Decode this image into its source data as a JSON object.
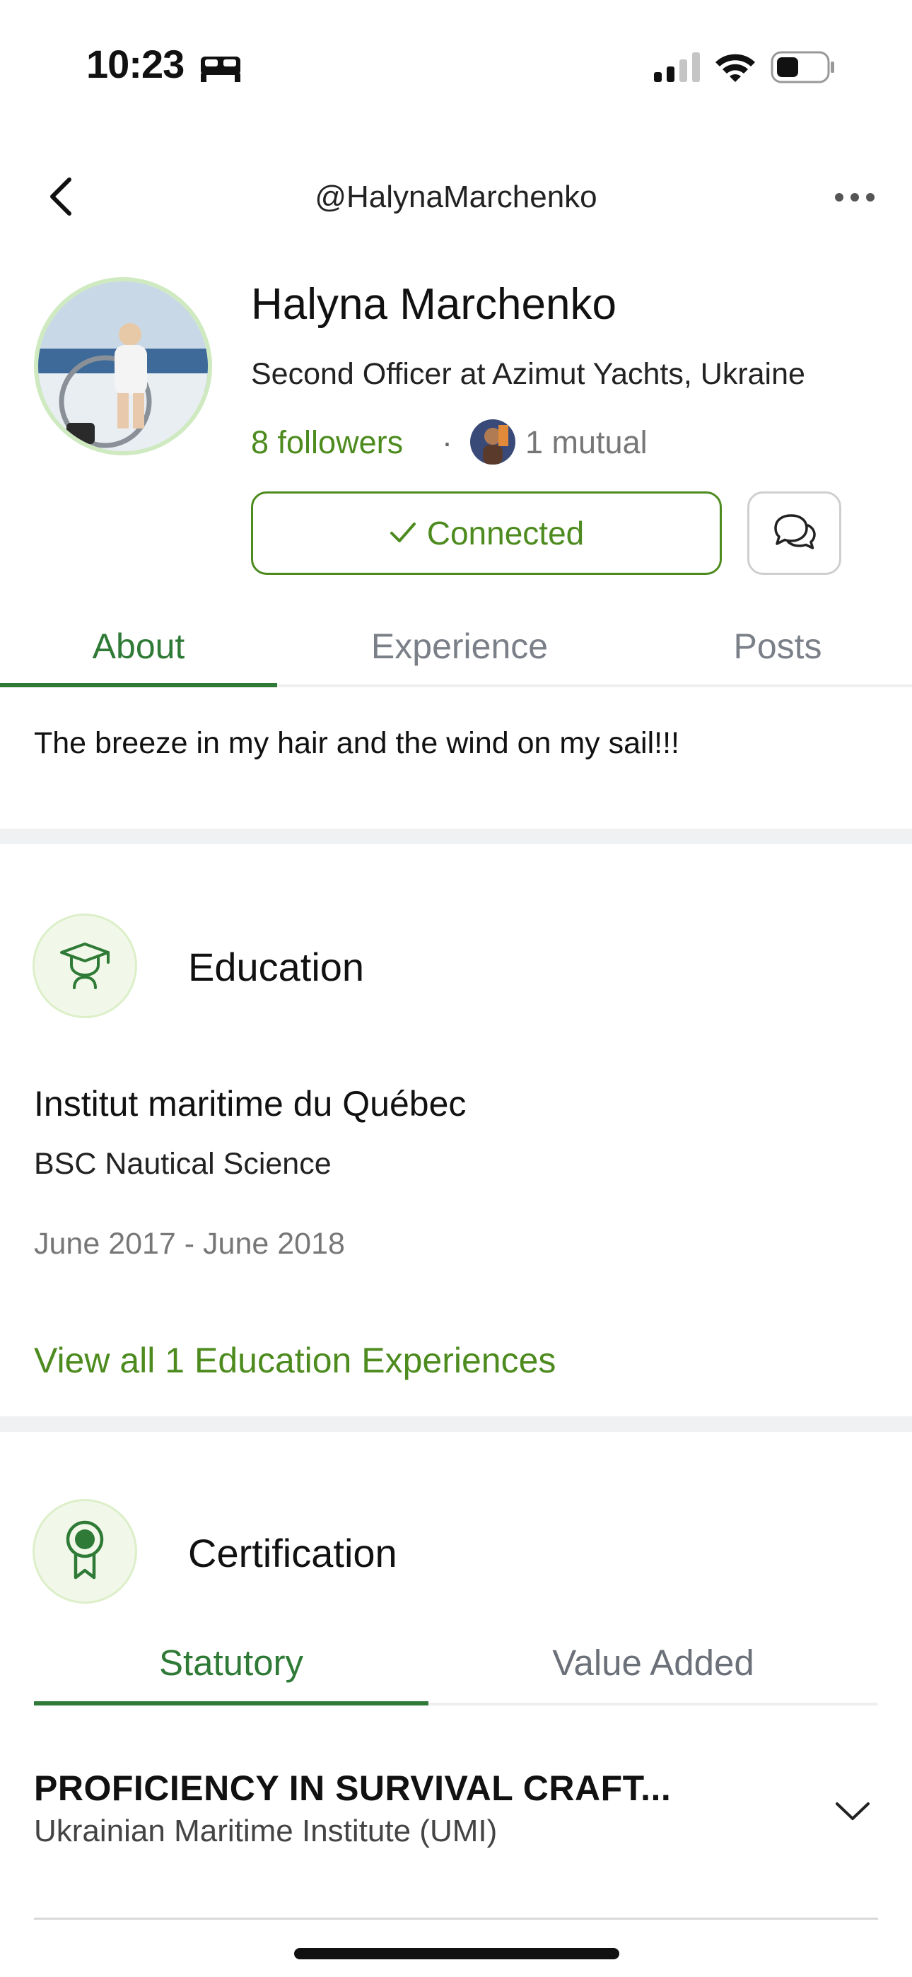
{
  "status_bar": {
    "time": "10:23",
    "icons": [
      "bed-icon",
      "signal-icon",
      "wifi-icon",
      "battery-icon"
    ]
  },
  "nav": {
    "handle": "@HalynaMarchenko",
    "icons": [
      "back-icon",
      "more-icon"
    ]
  },
  "profile": {
    "name": "Halyna Marchenko",
    "headline": "Second Officer at Azimut Yachts, Ukraine",
    "followers": "8 followers",
    "separator": "·",
    "mutual": "1 mutual",
    "connect_label": "Connected",
    "accent": "#4d8b1f"
  },
  "tabs": [
    {
      "label": "About",
      "active": true
    },
    {
      "label": "Experience",
      "active": false
    },
    {
      "label": "Posts",
      "active": false
    }
  ],
  "about": {
    "bio": "The breeze in my hair and the wind on my sail!!!"
  },
  "education": {
    "title": "Education",
    "institution": "Institut maritime du Québec",
    "degree": "BSC Nautical Science",
    "dates": "June 2017 - June 2018",
    "view_all": "View all 1 Education Experiences"
  },
  "certification": {
    "title": "Certification",
    "tabs": [
      {
        "label": "Statutory",
        "active": true
      },
      {
        "label": "Value Added",
        "active": false
      }
    ],
    "items": [
      {
        "name": "PROFICIENCY IN SURVIVAL CRAFT...",
        "issuer": "Ukrainian Maritime Institute (UMI)"
      }
    ]
  }
}
